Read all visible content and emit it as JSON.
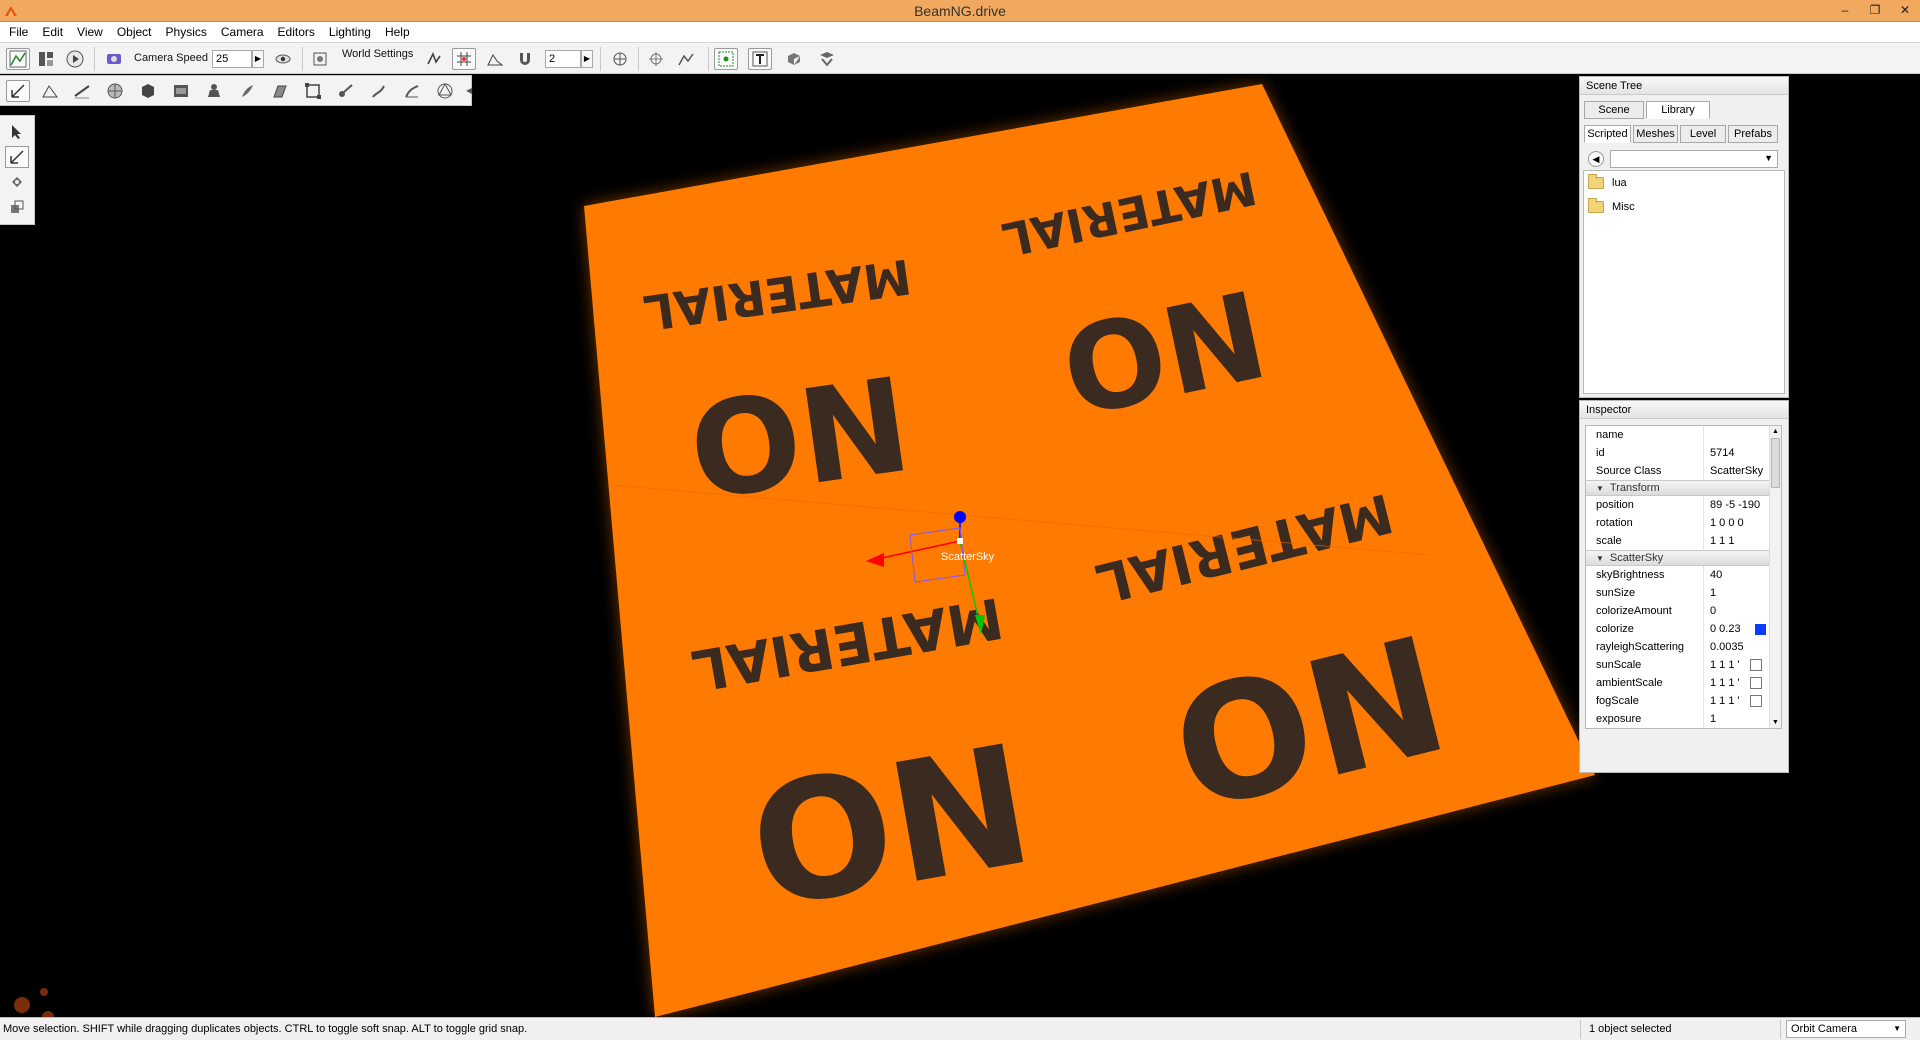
{
  "window": {
    "title": "BeamNG.drive",
    "minimize": "–",
    "restore": "❐",
    "close": "✕"
  },
  "menu": [
    "File",
    "Edit",
    "View",
    "Object",
    "Physics",
    "Camera",
    "Editors",
    "Lighting",
    "Help"
  ],
  "toolbar": {
    "camera_speed_label": "Camera Speed",
    "camera_speed_value": "25",
    "world_settings_label": "World Settings",
    "grid_value": "2"
  },
  "viewport": {
    "plane_color": "#ff7a00",
    "placeholder_word_top": "MATERIAL",
    "placeholder_word_bottom": "NO",
    "selected_object_label": "ScatterSky",
    "gizmo_colors": {
      "x": "#ff0000",
      "y": "#00c800",
      "z": "#0000ff"
    }
  },
  "scene_tree": {
    "title": "Scene Tree",
    "tabs": [
      {
        "label": "Scene",
        "active": false
      },
      {
        "label": "Library",
        "active": true
      }
    ],
    "subtabs": [
      {
        "label": "Scripted",
        "active": true
      },
      {
        "label": "Meshes",
        "active": false
      },
      {
        "label": "Level",
        "active": false
      },
      {
        "label": "Prefabs",
        "active": false
      }
    ],
    "items": [
      {
        "label": "lua",
        "icon": "folder-icon"
      },
      {
        "label": "Misc",
        "icon": "folder-icon"
      }
    ]
  },
  "inspector": {
    "title": "Inspector",
    "general": [
      {
        "key": "name",
        "value": ""
      },
      {
        "key": "id",
        "value": "5714"
      },
      {
        "key": "Source Class",
        "value": "ScatterSky"
      }
    ],
    "transform_title": "Transform",
    "transform": [
      {
        "key": "position",
        "value": "89 -5 -190"
      },
      {
        "key": "rotation",
        "value": "1 0 0 0"
      },
      {
        "key": "scale",
        "value": "1 1 1"
      }
    ],
    "scattersky_title": "ScatterSky",
    "scattersky": [
      {
        "key": "skyBrightness",
        "value": "40"
      },
      {
        "key": "sunSize",
        "value": "1"
      },
      {
        "key": "colorizeAmount",
        "value": "0"
      },
      {
        "key": "colorize",
        "value": "0 0.23"
      },
      {
        "key": "rayleighScattering",
        "value": "0.0035"
      },
      {
        "key": "sunScale",
        "value": "1 1 1 '"
      },
      {
        "key": "ambientScale",
        "value": "1 1 1 '"
      },
      {
        "key": "fogScale",
        "value": "1 1 1 '"
      },
      {
        "key": "exposure",
        "value": "1"
      }
    ],
    "colorize_swatch": "#0a3cff"
  },
  "status": {
    "message": "Move selection.  SHIFT while dragging duplicates objects.  CTRL to toggle soft snap.  ALT to toggle grid snap.",
    "selection": "1 object selected",
    "camera_mode": "Orbit Camera"
  }
}
